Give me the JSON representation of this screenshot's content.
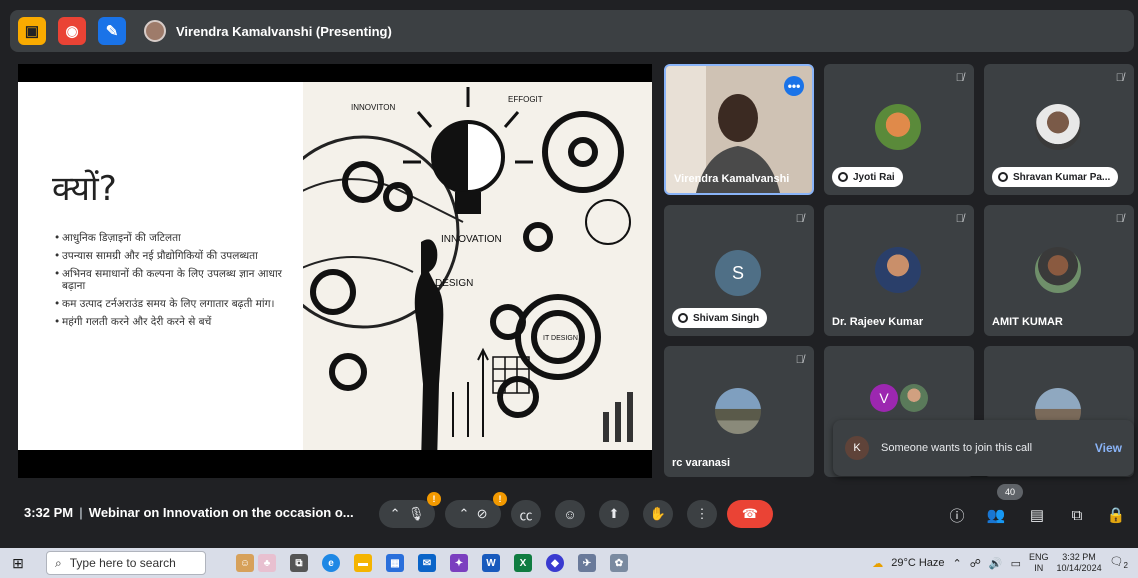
{
  "topbar": {
    "presenter_label": "Virendra Kamalvanshi (Presenting)",
    "icons": [
      "cast-icon",
      "record-icon",
      "pen-icon"
    ]
  },
  "slide": {
    "title": "क्यों?",
    "bullets": [
      "आधुनिक डिज़ाइनों की जटिलता",
      "उपन्यास सामग्री और नई प्रौद्योगिकियों की उपलब्धता",
      "अभिनव समाधानों की कल्पना के लिए उपलब्ध ज्ञान आधार बढ़ाना",
      "कम उत्पाद टर्नअराउंड समय के लिए लगातार बढ़ती मांग।",
      "महंगी गलती करने और देरी करने से बचें"
    ],
    "illustration_labels": [
      "INNOVITON",
      "EFFOGIT",
      "INNOVATION",
      "DESIGN",
      "IT DESIGN"
    ]
  },
  "participants": [
    {
      "name": "Virendra Kamalvanshi",
      "style": "plain",
      "active": true
    },
    {
      "name": "Jyoti Rai",
      "style": "pill",
      "muted": true
    },
    {
      "name": "Shravan Kumar Pa...",
      "style": "pill",
      "muted": true
    },
    {
      "name": "Shivam Singh",
      "style": "pill",
      "muted": true,
      "initial": "S"
    },
    {
      "name": "Dr. Rajeev Kumar",
      "style": "plain",
      "muted": true
    },
    {
      "name": "AMIT KUMAR",
      "style": "plain",
      "muted": true
    },
    {
      "name": "rc varanasi",
      "style": "plain",
      "muted": true
    },
    {
      "name": "",
      "style": "plain",
      "initial": "V"
    },
    {
      "name": "",
      "style": "plain"
    }
  ],
  "toast": {
    "initial": "K",
    "message": "Someone wants to join this call",
    "action": "View"
  },
  "controls": {
    "time": "3:32 PM",
    "separator": "|",
    "meeting_title": "Webinar on Innovation on the occasion o...",
    "mic_badge": "!",
    "cam_badge": "!",
    "participant_count": "40"
  },
  "taskbar": {
    "search_placeholder": "Type here to search",
    "weather": "29°C  Haze",
    "lang": "ENG",
    "region": "IN",
    "time": "3:32 PM",
    "date": "10/14/2024",
    "notif_count": "2"
  },
  "colors": {
    "background": "#202124",
    "tile": "#3c4043",
    "accent_blue": "#8ab4f8",
    "hangup_red": "#ea4335",
    "warning_orange": "#f29900"
  }
}
